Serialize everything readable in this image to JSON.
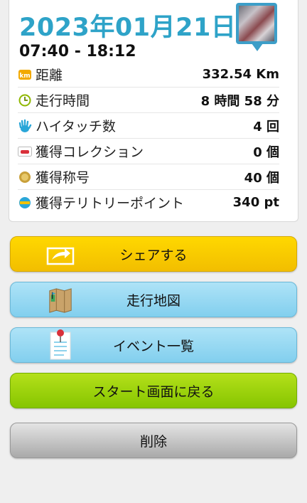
{
  "header": {
    "date": "2023年01月21日",
    "time_range": "07:40 - 18:12"
  },
  "stats": [
    {
      "icon": "km-badge-icon",
      "label": "距離",
      "value": "332.54 Km"
    },
    {
      "icon": "clock-icon",
      "label": "走行時間",
      "value": "8 時間 58 分"
    },
    {
      "icon": "high-five-hand-icon",
      "label": "ハイタッチ数",
      "value": "4 回"
    },
    {
      "icon": "collection-card-icon",
      "label": "獲得コレクション",
      "value": "0 個"
    },
    {
      "icon": "title-medal-icon",
      "label": "獲得称号",
      "value": "40 個"
    },
    {
      "icon": "spot-point-icon",
      "label": "獲得テリトリーポイント",
      "value": "340 pt"
    }
  ],
  "buttons": {
    "share": "シェアする",
    "map": "走行地図",
    "event_list": "イベント一覧",
    "back_to_start": "スタート画面に戻る",
    "delete": "削除"
  },
  "colors": {
    "date_blue": "#2ea3c8",
    "share_yellow": "#ffd800",
    "light_blue": "#82cfee",
    "green": "#86c500",
    "gray": "#a9a9a9"
  }
}
